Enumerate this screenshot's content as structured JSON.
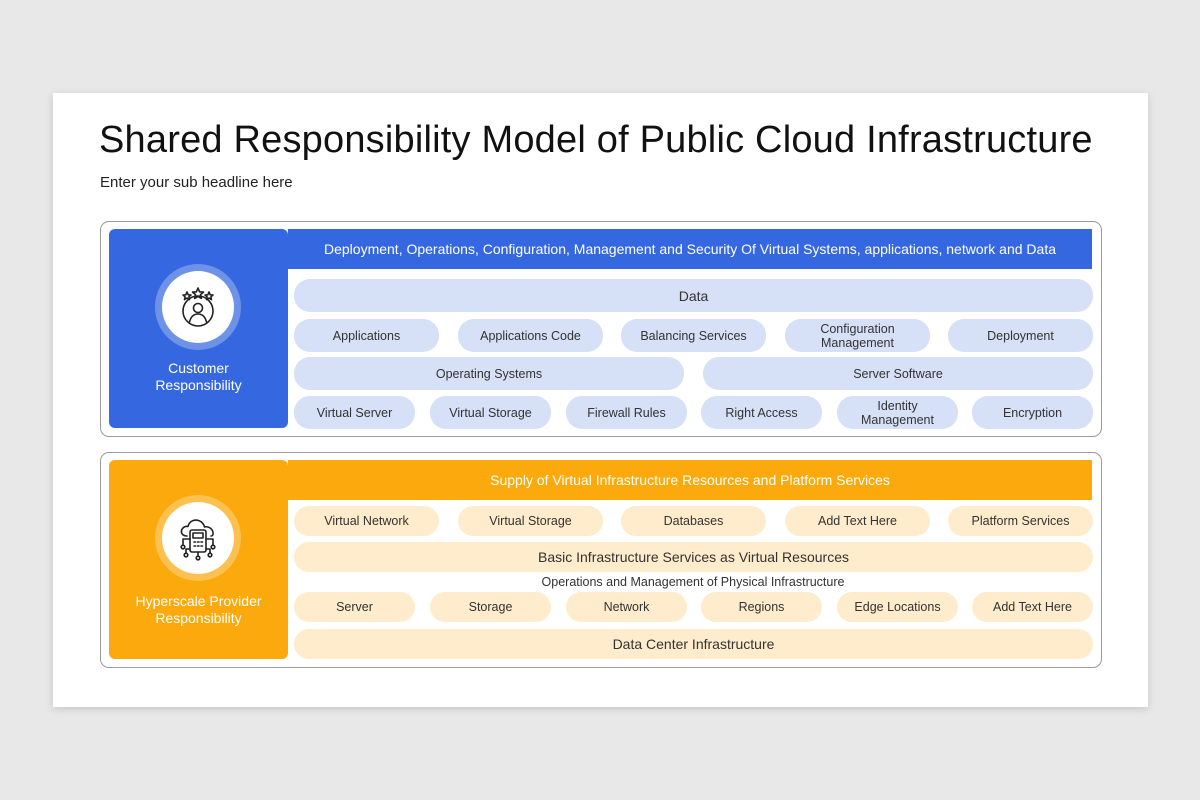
{
  "title": "Shared Responsibility Model of Public Cloud Infrastructure",
  "subtitle": "Enter your sub headline here",
  "colors": {
    "customer": "#3568e0",
    "customer_light": "#d6e0f6",
    "provider": "#fba90d",
    "provider_light": "#ffeccc"
  },
  "customer": {
    "icon": "user-stars-icon",
    "label_line1": "Customer",
    "label_line2": "Responsibility",
    "header": "Deployment, Operations, Configuration, Management and Security Of Virtual Systems, applications, network and Data",
    "data": "Data",
    "row2": [
      "Applications",
      "Applications Code",
      "Balancing Services",
      "Configuration Management",
      "Deployment"
    ],
    "row3": [
      "Operating Systems",
      "Server Software"
    ],
    "row4": [
      "Virtual Server",
      "Virtual Storage",
      "Firewall Rules",
      "Right Access",
      "Identity Management",
      "Encryption"
    ]
  },
  "provider": {
    "icon": "cloud-server-icon",
    "label_line1": "Hyperscale Provider",
    "label_line2": "Responsibility",
    "header": "Supply of Virtual Infrastructure Resources and Platform Services",
    "row1": [
      "Virtual Network",
      "Virtual Storage",
      "Databases",
      "Add Text Here",
      "Platform Services"
    ],
    "basic": "Basic Infrastructure Services as Virtual Resources",
    "ops": "Operations and Management of Physical Infrastructure",
    "row3": [
      "Server",
      "Storage",
      "Network",
      "Regions",
      "Edge Locations",
      "Add Text Here"
    ],
    "datacenter": "Data Center Infrastructure"
  }
}
